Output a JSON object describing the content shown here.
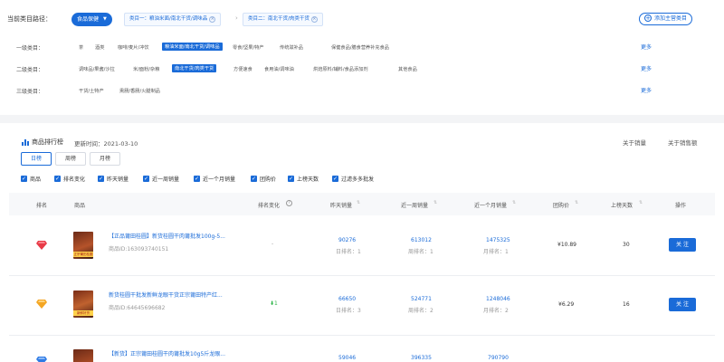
{
  "path": {
    "label": "当前类目路径：",
    "selected": "食品保健",
    "tags": [
      "类目一：粮油米面/南北干货/调味品",
      "类目二：南北干货/肉类干货"
    ],
    "add_button": "添加主营类目"
  },
  "category_rows": [
    {
      "label": "一级类目：",
      "options": [
        "茶",
        "酒类",
        "咖啡/麦片/冲饮",
        "粮油米面/南北干货/调味品",
        "零食/坚果/特产",
        "传统滋补品",
        "保健食品/膳食营养补充食品"
      ],
      "active_index": 3,
      "more": "更多"
    },
    {
      "label": "二级类目：",
      "options": [
        "调味品/果酱/沙拉",
        "米/面粉/杂粮",
        "南北干货/肉类干货",
        "方便速食",
        "食用油/调味油",
        "烘焙原料/辅料/食品添加剂",
        "其他食品"
      ],
      "active_index": 2,
      "more": "更多"
    },
    {
      "label": "三级类目：",
      "options": [
        "干货/土特产",
        "熏肠/香肠/火腿制品"
      ],
      "active_index": -1,
      "more": "更多"
    }
  ],
  "ranking": {
    "title": "商品排行榜",
    "update": "更新时间：2021-03-10",
    "about_sales": "关于销量",
    "about_amount": "关于销售额",
    "tabs": [
      "日榜",
      "周榜",
      "月榜"
    ],
    "active_tab": 0,
    "filters": [
      "商品",
      "排名变化",
      "昨天销量",
      "近一周销量",
      "近一个月销量",
      "团购价",
      "上榜天数",
      "过滤多多批发"
    ],
    "columns": [
      "排名",
      "商品",
      "排名变化",
      "昨天销量",
      "近一周销量",
      "近一个月销量",
      "团购价",
      "上榜天数",
      "操作"
    ],
    "rows": [
      {
        "title": "【正品莆田桂圆】新货桂圆干肉莆批发100g-5...",
        "id": "商品ID:163093740151",
        "change": "-",
        "yesterday": "90276",
        "yesterday_rank": "日排名：1",
        "week": "613012",
        "week_rank": "周排名：1",
        "month": "1475325",
        "month_rank": "月排名：1",
        "price": "¥10.89",
        "days": "30",
        "action": "关 注",
        "gem_color": "#e83a47",
        "thumb_label": "正宗莆田桂圆"
      },
      {
        "title": "新货桂圆干批发新鲜龙眼干货正宗莆田特产红...",
        "id": "商品ID:64645696682",
        "change": "1",
        "yesterday": "66650",
        "yesterday_rank": "日排名：3",
        "week": "524771",
        "week_rank": "周排名：2",
        "month": "1248046",
        "month_rank": "月排名：2",
        "price": "¥6.29",
        "days": "16",
        "action": "关 注",
        "gem_color": "#f4a623",
        "thumb_label": "新鲜好货"
      },
      {
        "title": "【新货】正宗莆田桂圆干肉莆批发10g5斤龙眼...",
        "id": "",
        "change": "",
        "yesterday": "59046",
        "yesterday_rank": "",
        "week": "396335",
        "week_rank": "",
        "month": "790790",
        "month_rank": "",
        "price": "",
        "days": "",
        "action": "",
        "gem_color": "#2f7be5",
        "thumb_label": ""
      }
    ]
  }
}
